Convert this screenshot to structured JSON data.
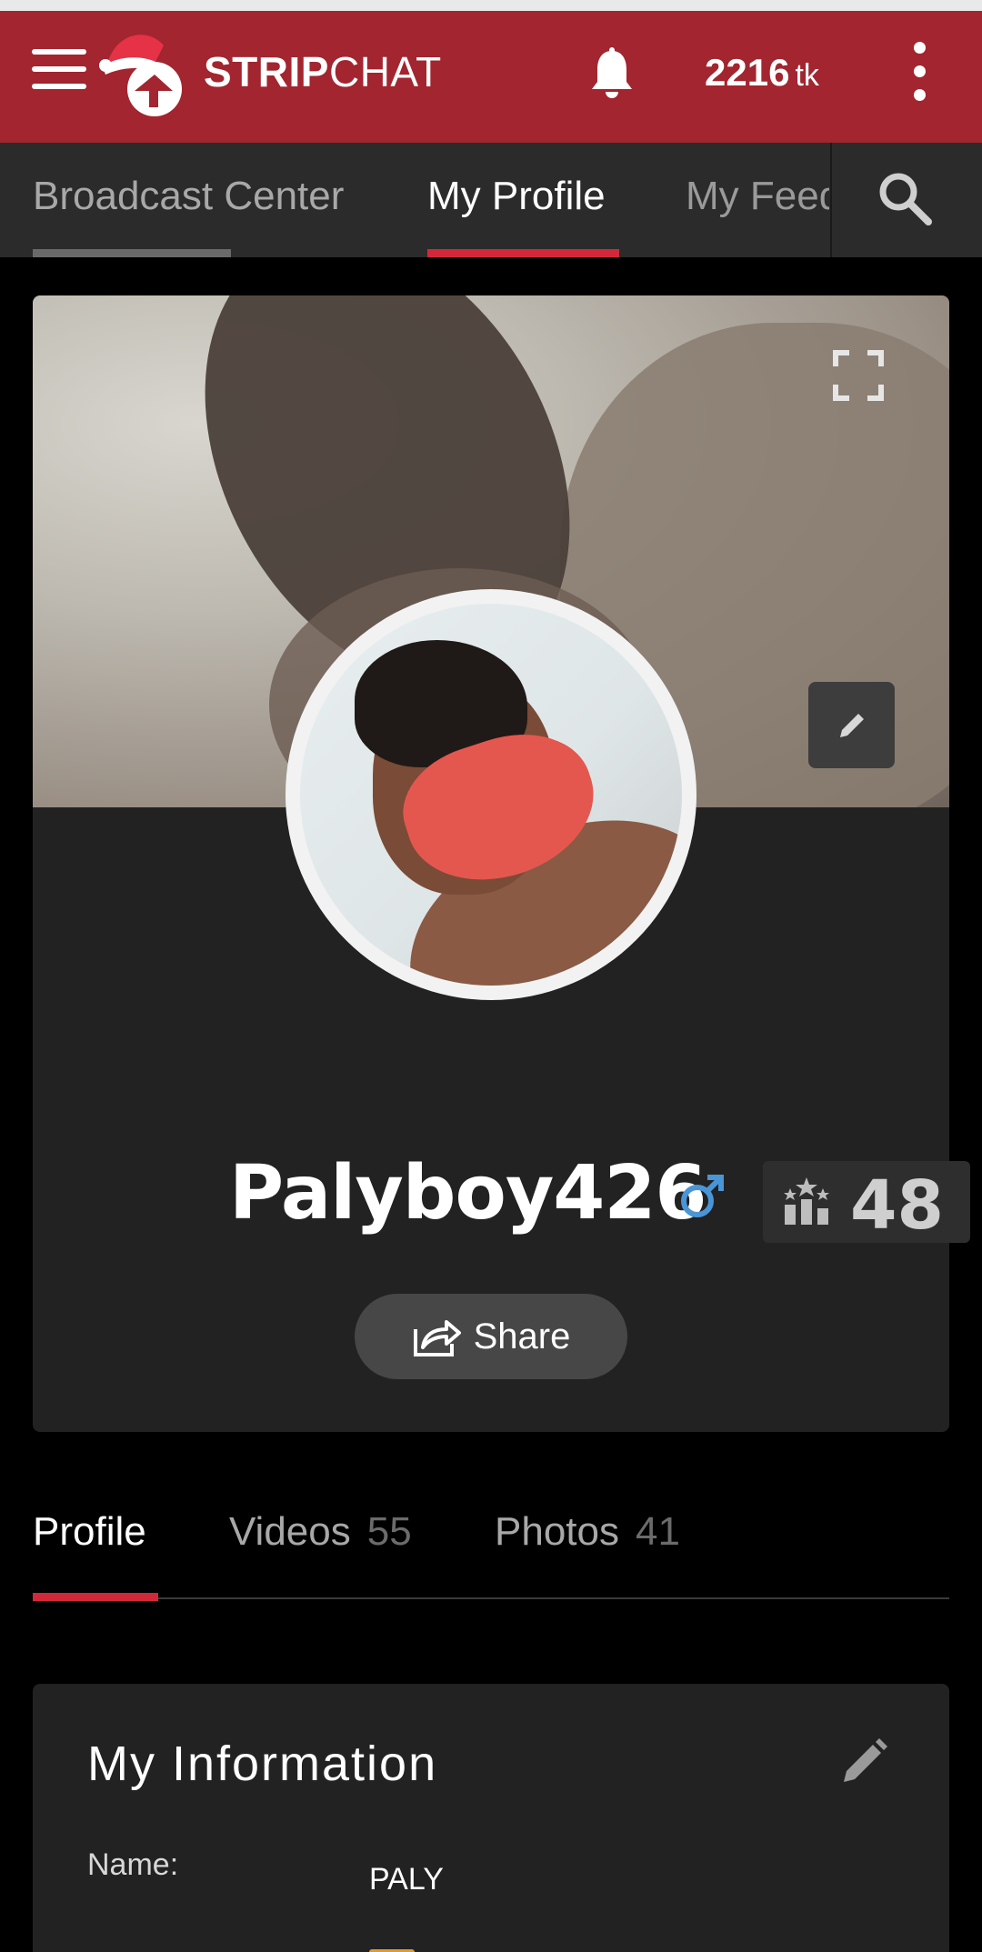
{
  "header": {
    "logo_strip": "STRIP",
    "logo_chat": "CHAT",
    "tokens_value": "2216",
    "tokens_unit": "tk",
    "brand_color": "#a2252f"
  },
  "topnav": {
    "tabs": [
      {
        "label": "Broadcast Center"
      },
      {
        "label": "My Profile",
        "active": true
      },
      {
        "label": "My Feed"
      }
    ],
    "active_color": "#d3283a"
  },
  "profile": {
    "username": "Palyboy426",
    "gender_icon": "male-symbol-icon",
    "level": "48",
    "share_label": "Share"
  },
  "section_tabs": [
    {
      "label": "Profile",
      "count": "",
      "active": true
    },
    {
      "label": "Videos",
      "count": "55"
    },
    {
      "label": "Photos",
      "count": "41"
    }
  ],
  "info": {
    "title": "My Information",
    "rows": [
      {
        "label": "Name:",
        "value": "PALY"
      }
    ]
  }
}
